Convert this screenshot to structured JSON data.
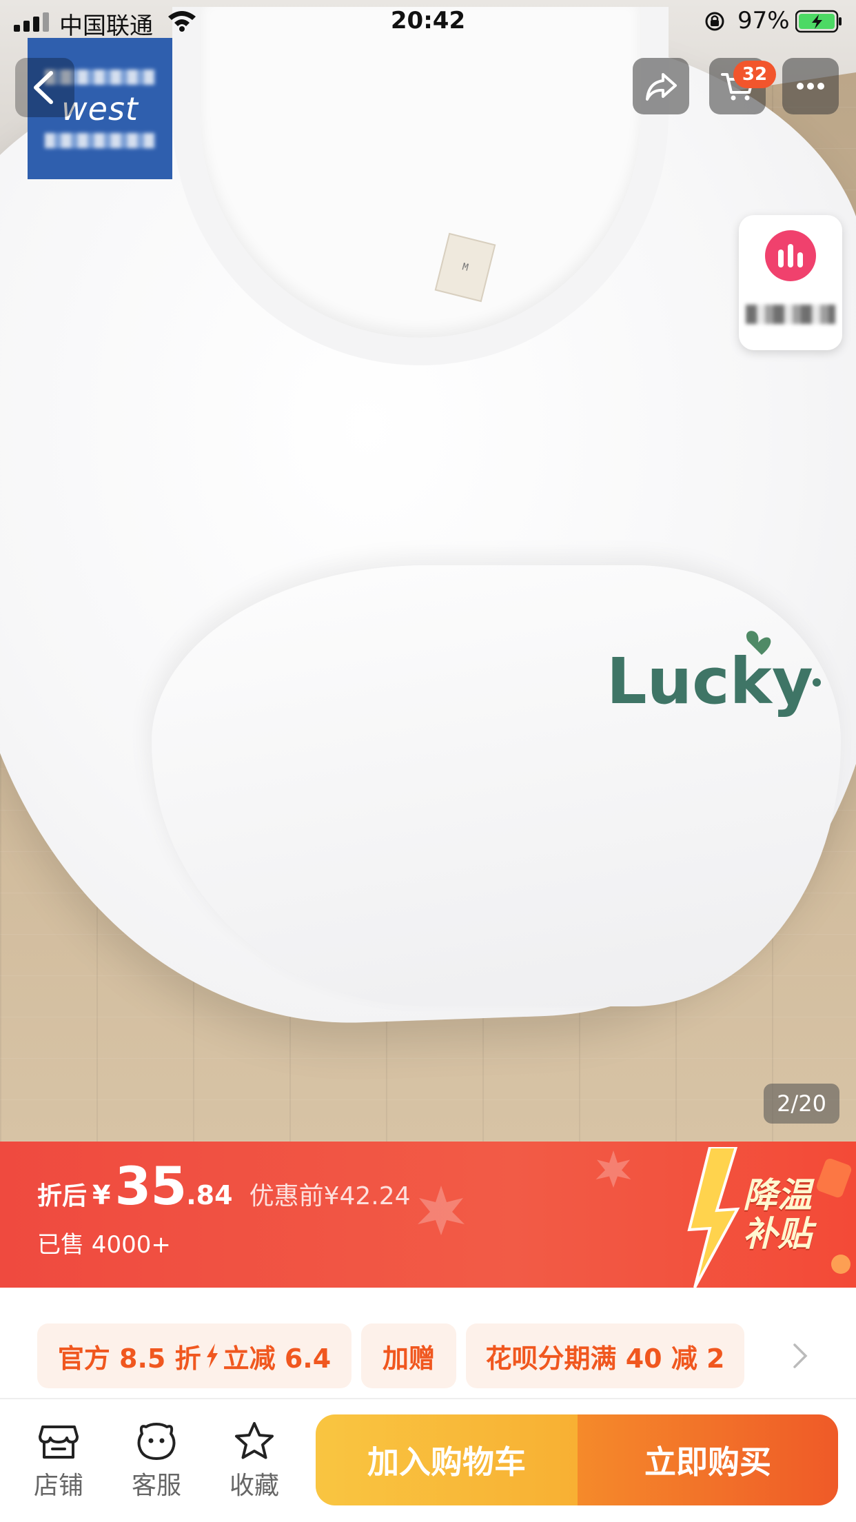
{
  "status_bar": {
    "carrier": "中国联通",
    "time": "20:42",
    "battery": "97%"
  },
  "shop_badge": {
    "brand": "west"
  },
  "header": {
    "cart_count": "32",
    "icons": [
      "back-icon",
      "share-icon",
      "cart-icon",
      "more-icon"
    ]
  },
  "live_widget": {
    "icon": "live-bars-icon",
    "color": "#f0416d"
  },
  "product_image": {
    "print_text": "Lucky",
    "size_tag": "M",
    "counter": "2/20"
  },
  "price": {
    "prefix": "折后",
    "currency": "¥",
    "integer": "35",
    "decimal": ".84",
    "before": "优惠前¥42.24",
    "sold": "已售 4000+",
    "promo_line1": "降温",
    "promo_line2": "补贴",
    "banner_color": "#ef4a3f"
  },
  "coupons": {
    "official_a": "官方 8.5 折",
    "official_b": "立减 6.4",
    "gift": "加赠",
    "installment": "花呗分期满 40 减 2",
    "accent_color": "#f0571f"
  },
  "bottom_bar": {
    "shop": "店铺",
    "service": "客服",
    "favorite": "收藏",
    "add_to_cart": "加入购物车",
    "buy_now": "立即购买"
  }
}
